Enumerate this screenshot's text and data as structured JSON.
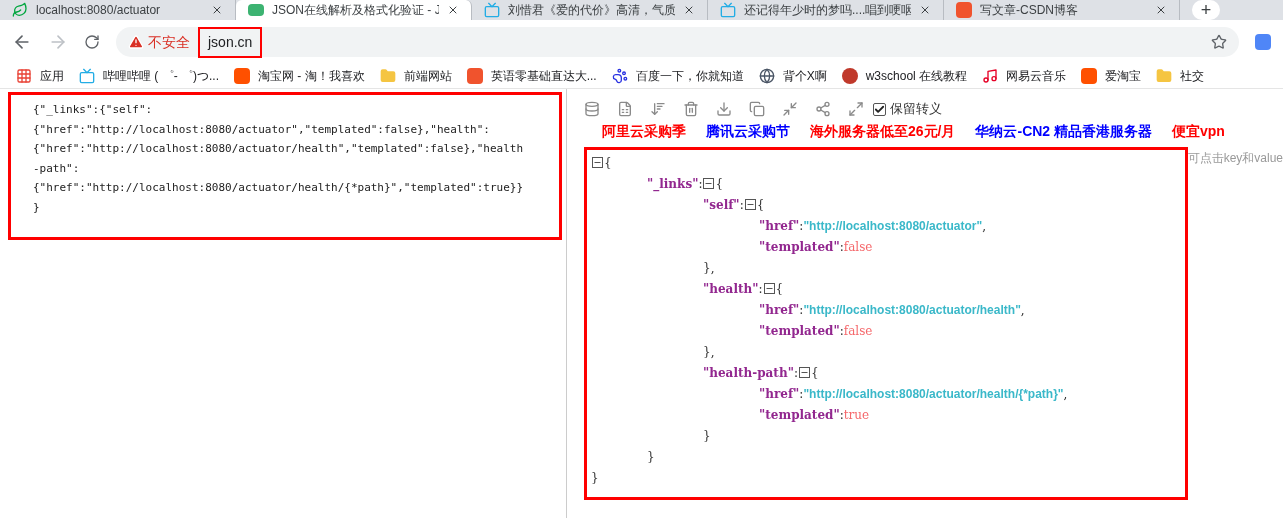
{
  "tabs": [
    {
      "title": "localhost:8080/actuator",
      "selected": false
    },
    {
      "title": "JSON在线解析及格式化验证 - J",
      "selected": true
    },
    {
      "title": "刘惜君《爱的代价》高清，气质",
      "selected": false
    },
    {
      "title": "还记得年少时的梦吗....唱到哽咽",
      "selected": false
    },
    {
      "title": "写文章-CSDN博客",
      "selected": false
    }
  ],
  "new_tab": "+",
  "address_bar": {
    "security": "不安全",
    "url": "json.cn"
  },
  "bookmarks": [
    {
      "label": "应用"
    },
    {
      "label": "哔哩哔哩 ( ゜- ゜)つ..."
    },
    {
      "label": "淘宝网 - 淘！我喜欢"
    },
    {
      "label": "前端网站"
    },
    {
      "label": "英语零基础直达大..."
    },
    {
      "label": "百度一下，你就知道"
    },
    {
      "label": "背个X啊"
    },
    {
      "label": "w3school 在线教程"
    },
    {
      "label": "网易云音乐"
    },
    {
      "label": "爱淘宝"
    },
    {
      "label": "社交"
    }
  ],
  "raw_input": {
    "lines": [
      "{\"_links\":{\"self\":",
      "{\"href\":\"http://localhost:8080/actuator\",\"templated\":false},\"health\":",
      "{\"href\":\"http://localhost:8080/actuator/health\",\"templated\":false},\"health",
      "-path\":",
      "{\"href\":\"http://localhost:8080/actuator/health/{*path}\",\"templated\":true}}",
      "}"
    ]
  },
  "toolbar": {
    "escape_option": {
      "label": "保留转义",
      "checked": true
    }
  },
  "ads": [
    {
      "label": "阿里云采购季",
      "color": "#ff0000"
    },
    {
      "label": "腾讯云采购节",
      "color": "#0000ff"
    },
    {
      "label": "海外服务器低至26元/月",
      "color": "#ff0000"
    },
    {
      "label": "华纳云-CN2 精品香港服务器",
      "color": "#0000ff"
    },
    {
      "label": "便宜vpn",
      "color": "#ff0000"
    }
  ],
  "hint": "可点击key和value",
  "tree": {
    "punct": {
      "quote": "\"",
      "colon": ":",
      "open": "{",
      "close": "}",
      "comma": ","
    },
    "root": {
      "expanded": true,
      "children": [
        {
          "key": "_links",
          "expanded": true,
          "children": [
            {
              "key": "self",
              "expanded": true,
              "children": [
                {
                  "key": "href",
                  "kind": "string",
                  "value": "http://localhost:8080/actuator"
                },
                {
                  "key": "templated",
                  "kind": "boolean",
                  "value": "false"
                }
              ]
            },
            {
              "key": "health",
              "expanded": true,
              "children": [
                {
                  "key": "href",
                  "kind": "string",
                  "value": "http://localhost:8080/actuator/health"
                },
                {
                  "key": "templated",
                  "kind": "boolean",
                  "value": "false"
                }
              ]
            },
            {
              "key": "health-path",
              "expanded": true,
              "children": [
                {
                  "key": "href",
                  "kind": "string",
                  "value": "http://localhost:8080/actuator/health/{*path}"
                },
                {
                  "key": "templated",
                  "kind": "boolean",
                  "value": "true"
                }
              ]
            }
          ]
        }
      ]
    }
  }
}
